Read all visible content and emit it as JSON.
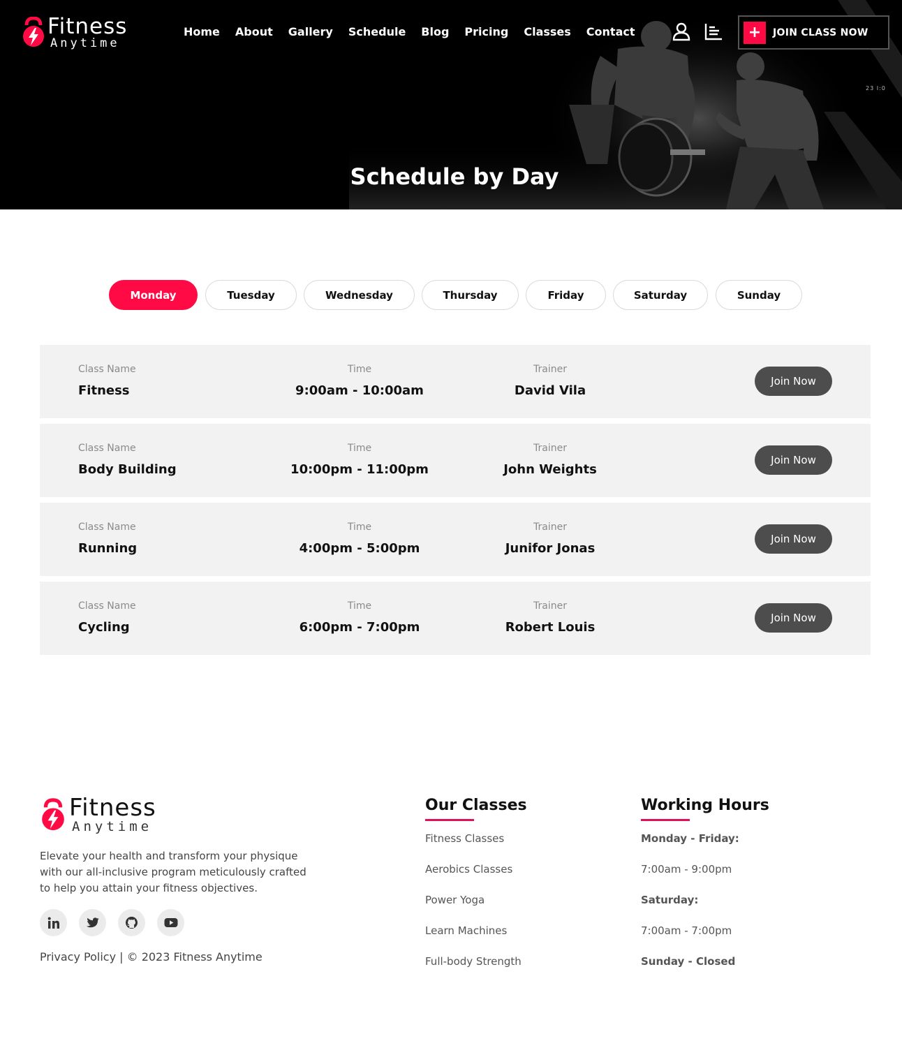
{
  "header": {
    "logo": {
      "brand": "Fitness",
      "sub": "Anytime"
    },
    "nav": [
      "Home",
      "About",
      "Gallery",
      "Schedule",
      "Blog",
      "Pricing",
      "Classes",
      "Contact"
    ],
    "icons": [
      "user-icon",
      "menu-icon"
    ],
    "cta": {
      "label": "JOIN CLASS NOW",
      "icon": "plus-icon"
    },
    "video_tag": "23 I:0"
  },
  "hero": {
    "title": "Schedule by Day"
  },
  "days": {
    "active": "Monday",
    "items": [
      "Monday",
      "Tuesday",
      "Wednesday",
      "Thursday",
      "Friday",
      "Saturday",
      "Sunday"
    ]
  },
  "schedule": {
    "labels": {
      "class": "Class Name",
      "time": "Time",
      "trainer": "Trainer",
      "join": "Join Now"
    },
    "rows": [
      {
        "class": "Fitness",
        "time": "9:00am - 10:00am",
        "trainer": "David Vila"
      },
      {
        "class": "Body Building",
        "time": "10:00pm - 11:00pm",
        "trainer": "John Weights"
      },
      {
        "class": "Running",
        "time": "4:00pm - 5:00pm",
        "trainer": "Junifor Jonas"
      },
      {
        "class": "Cycling",
        "time": "6:00pm - 7:00pm",
        "trainer": "Robert Louis"
      }
    ]
  },
  "footer": {
    "logo": {
      "brand": "Fitness",
      "sub": "Anytime"
    },
    "description": "Elevate your health and transform your physique with our all-inclusive program meticulously crafted to help you attain your fitness objectives.",
    "socials": [
      "linkedin-icon",
      "twitter-icon",
      "github-icon",
      "youtube-icon"
    ],
    "copyright": "Privacy Policy | © 2023 Fitness Anytime",
    "classes": {
      "title": "Our Classes",
      "items": [
        "Fitness Classes",
        "Aerobics Classes",
        "Power Yoga",
        "Learn Machines",
        "Full-body Strength"
      ]
    },
    "hours": {
      "title": "Working Hours",
      "items": [
        "Monday - Friday:",
        "7:00am - 9:00pm",
        "Saturday:",
        "7:00am - 7:00pm",
        "Sunday - Closed"
      ]
    }
  },
  "colors": {
    "accent": "#ff0a44",
    "underline": "#e0105a",
    "row_bg": "#f2f2f2",
    "button_dark": "#4d4d4d"
  }
}
